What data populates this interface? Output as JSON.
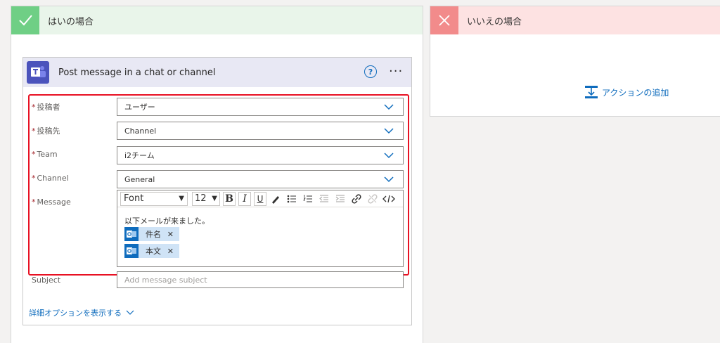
{
  "yes_branch": {
    "title": "はいの場合",
    "accent": "#6fcf85",
    "header_bg": "#e9f5ea"
  },
  "no_branch": {
    "title": "いいえの場合",
    "accent": "#f28b8b",
    "header_bg": "#fde2e2",
    "add_action_label": "アクションの追加"
  },
  "card": {
    "title": "Post message in a chat or channel",
    "app_icon": "teams-icon",
    "help_icon": "help-icon",
    "more_icon": "more-icon",
    "fields": [
      {
        "label": "投稿者",
        "required": true,
        "value": "ユーザー"
      },
      {
        "label": "投稿先",
        "required": true,
        "value": "Channel"
      },
      {
        "label": "Team",
        "required": true,
        "value": "i2チーム"
      },
      {
        "label": "Channel",
        "required": true,
        "value": "General"
      }
    ],
    "message": {
      "label": "Message",
      "required": true,
      "toolbar": {
        "font": "Font",
        "size": "12"
      },
      "text": "以下メールが来ました。",
      "tokens": [
        {
          "label": "件名"
        },
        {
          "label": "本文"
        }
      ]
    },
    "subject": {
      "label": "Subject",
      "placeholder": "Add message subject"
    },
    "advanced_link": "詳細オプションを表示する"
  },
  "colors": {
    "highlight": "#e81123",
    "link": "#0f6cbd",
    "teams": "#4b53bc"
  }
}
